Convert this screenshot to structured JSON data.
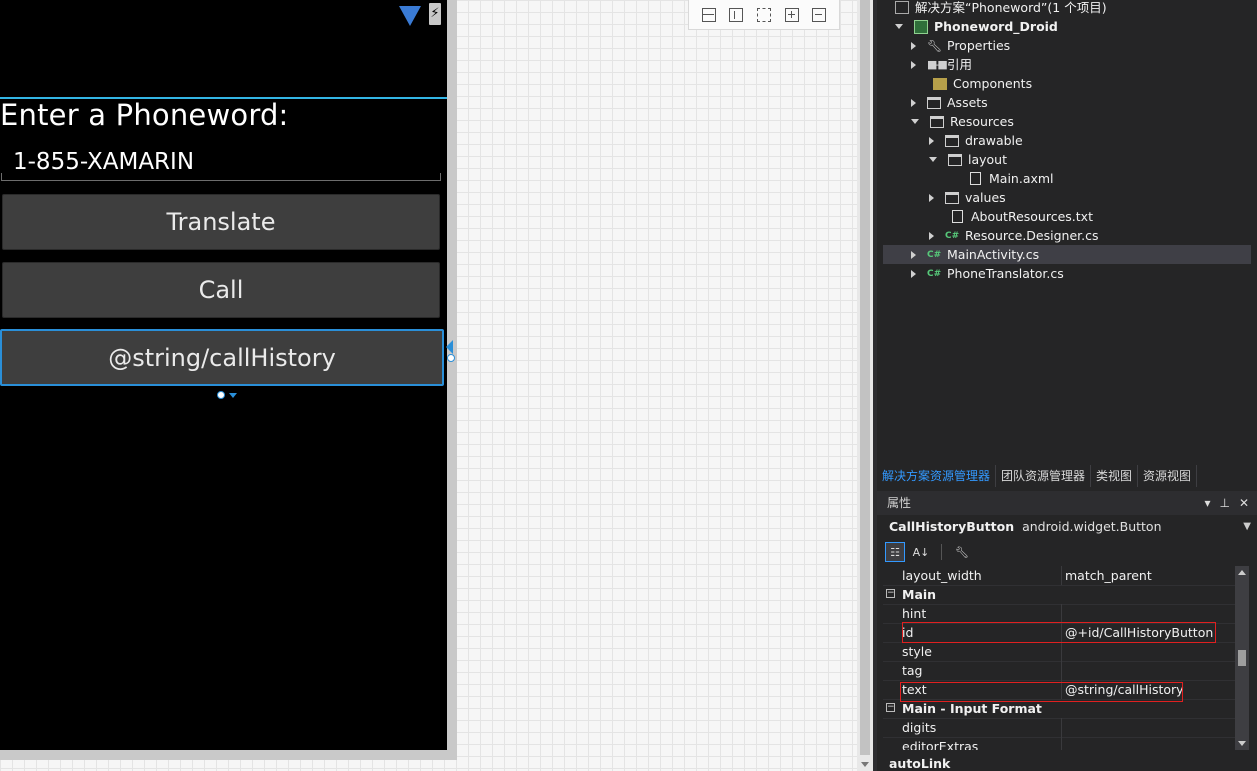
{
  "designer": {
    "phoneword_label": "Enter a Phoneword:",
    "phone_input_value": "1-855-XAMARIN",
    "translate_button": "Translate",
    "call_button": "Call",
    "call_history_button": "@string/callHistory"
  },
  "solution_explorer": {
    "solution_label": "解决方案“Phoneword”(1 个项目)",
    "project": "Phoneword_Droid",
    "items": [
      {
        "label": "Properties",
        "icon": "wrench-icon"
      },
      {
        "label": "引用",
        "icon": "references-icon"
      },
      {
        "label": "Components",
        "icon": "components-icon"
      },
      {
        "label": "Assets",
        "icon": "folder-icon"
      },
      {
        "label": "Resources",
        "icon": "folder-icon"
      },
      {
        "label": "drawable",
        "icon": "folder-icon"
      },
      {
        "label": "layout",
        "icon": "folder-icon"
      },
      {
        "label": "Main.axml",
        "icon": "file-icon"
      },
      {
        "label": "values",
        "icon": "folder-icon"
      },
      {
        "label": "AboutResources.txt",
        "icon": "file-icon"
      },
      {
        "label": "Resource.Designer.cs",
        "icon": "csharp-file-icon"
      },
      {
        "label": "MainActivity.cs",
        "icon": "csharp-file-icon"
      },
      {
        "label": "PhoneTranslator.cs",
        "icon": "csharp-file-icon"
      }
    ],
    "cs_badge": "C#",
    "tabs": [
      "解决方案资源管理器",
      "团队资源管理器",
      "类视图",
      "资源视图"
    ]
  },
  "properties": {
    "title": "属性",
    "object_name": "CallHistoryButton",
    "object_type": "android.widget.Button",
    "rows": [
      {
        "name": "layout_width",
        "value": "match_parent"
      },
      {
        "name": "Main",
        "value": ""
      },
      {
        "name": "hint",
        "value": ""
      },
      {
        "name": "id",
        "value": "@+id/CallHistoryButton"
      },
      {
        "name": "style",
        "value": ""
      },
      {
        "name": "tag",
        "value": ""
      },
      {
        "name": "text",
        "value": "@string/callHistory"
      },
      {
        "name": "Main - Input Format",
        "value": ""
      },
      {
        "name": "digits",
        "value": ""
      },
      {
        "name": "editorExtras",
        "value": ""
      }
    ],
    "next_row": "autoLink"
  },
  "colors": {
    "accent_blue": "#33b5e5",
    "selection_blue": "#2a8fd8",
    "highlight_red": "#e02020",
    "ide_dark": "#252526"
  }
}
